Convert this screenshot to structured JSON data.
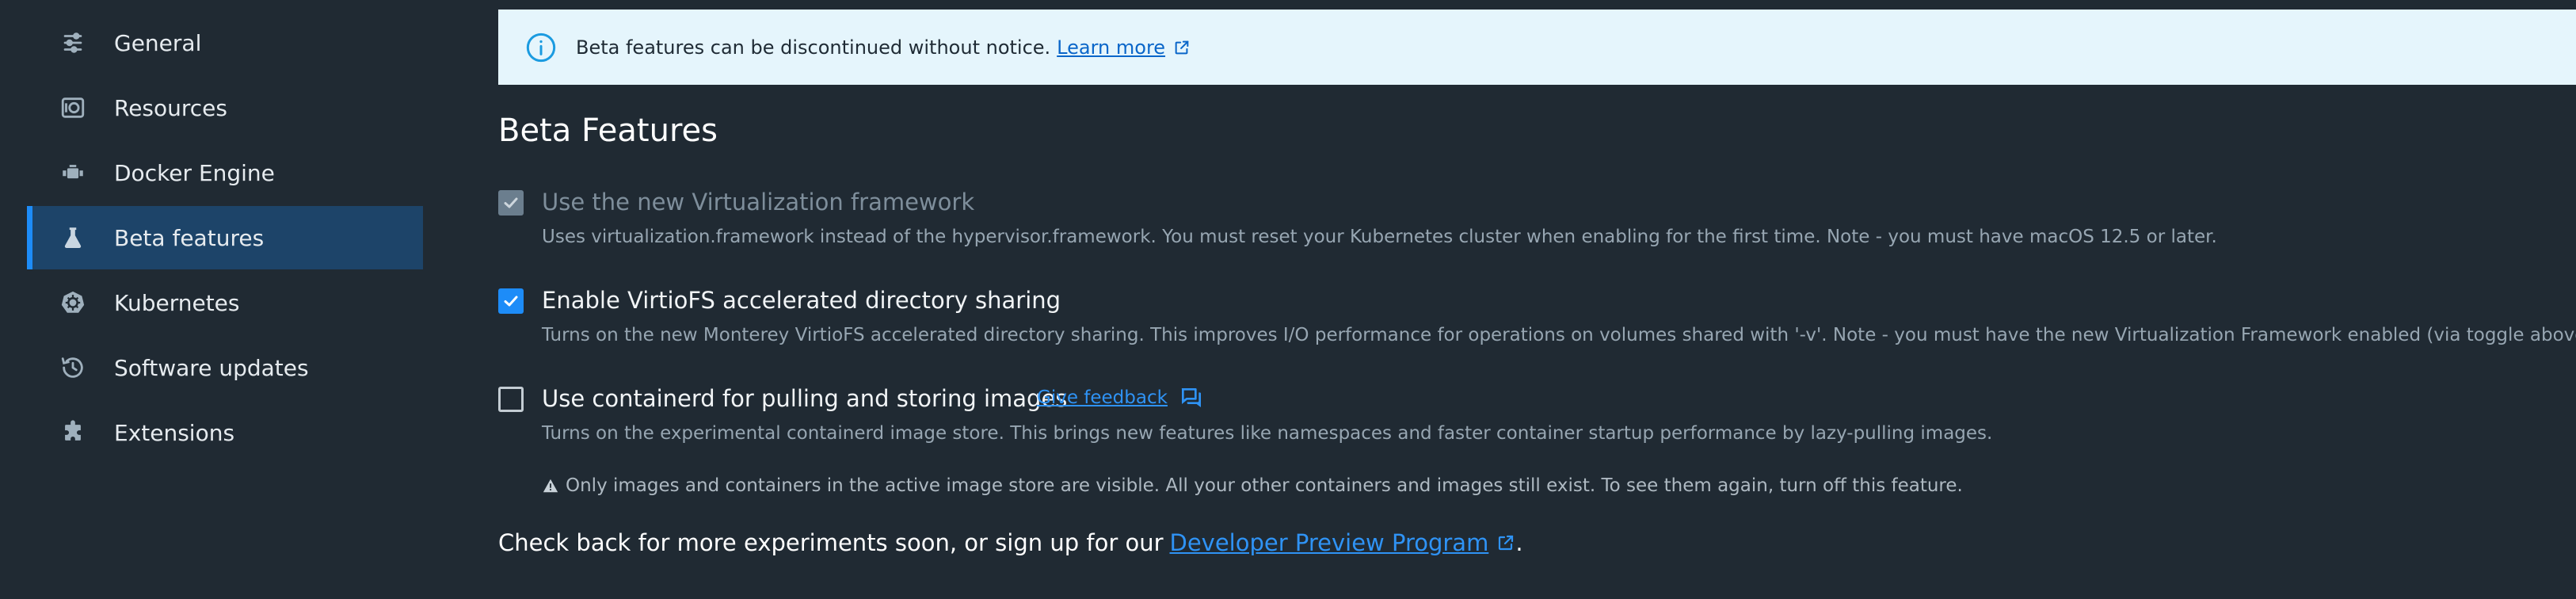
{
  "sidebar": {
    "items": [
      {
        "label": "General",
        "icon": "sliders-icon"
      },
      {
        "label": "Resources",
        "icon": "disk-icon"
      },
      {
        "label": "Docker Engine",
        "icon": "engine-icon"
      },
      {
        "label": "Beta features",
        "icon": "flask-icon",
        "active": true
      },
      {
        "label": "Kubernetes",
        "icon": "helm-icon"
      },
      {
        "label": "Software updates",
        "icon": "history-icon"
      },
      {
        "label": "Extensions",
        "icon": "puzzle-icon"
      }
    ]
  },
  "banner": {
    "text": "Beta features can be discontinued without notice.",
    "link": "Learn more"
  },
  "main": {
    "title": "Beta Features",
    "settings": [
      {
        "label": "Use the new Virtualization framework",
        "description": "Uses virtualization.framework instead of the hypervisor.framework. You must reset your Kubernetes cluster when enabling for the first time. Note - you must have macOS 12.5 or later.",
        "checked": true,
        "disabled": true
      },
      {
        "label": "Enable VirtioFS accelerated directory sharing",
        "description": "Turns on the new Monterey VirtioFS accelerated directory sharing. This improves I/O performance for operations on volumes shared with '-v'. Note - you must have the new Virtualization Framework enabled (via toggle above).",
        "checked": true,
        "disabled": false
      },
      {
        "label": "Use containerd for pulling and storing images",
        "feedback_link": "Give feedback",
        "description": "Turns on the experimental containerd image store. This brings new features like namespaces and faster container startup performance by lazy-pulling images.",
        "warning": "Only images and containers in the active image store are visible. All your other containers and images still exist. To see them again, turn off this feature.",
        "checked": false,
        "disabled": false
      }
    ],
    "footer": {
      "text": "Check back for more experiments soon, or sign up for our",
      "link": "Developer Preview Program",
      "suffix": "."
    }
  },
  "colors": {
    "background": "#202a33",
    "active_item": "#1d4469",
    "accent": "#1d8cf8",
    "banner_bg": "#e5f5fc",
    "link": "#2f93f5"
  }
}
